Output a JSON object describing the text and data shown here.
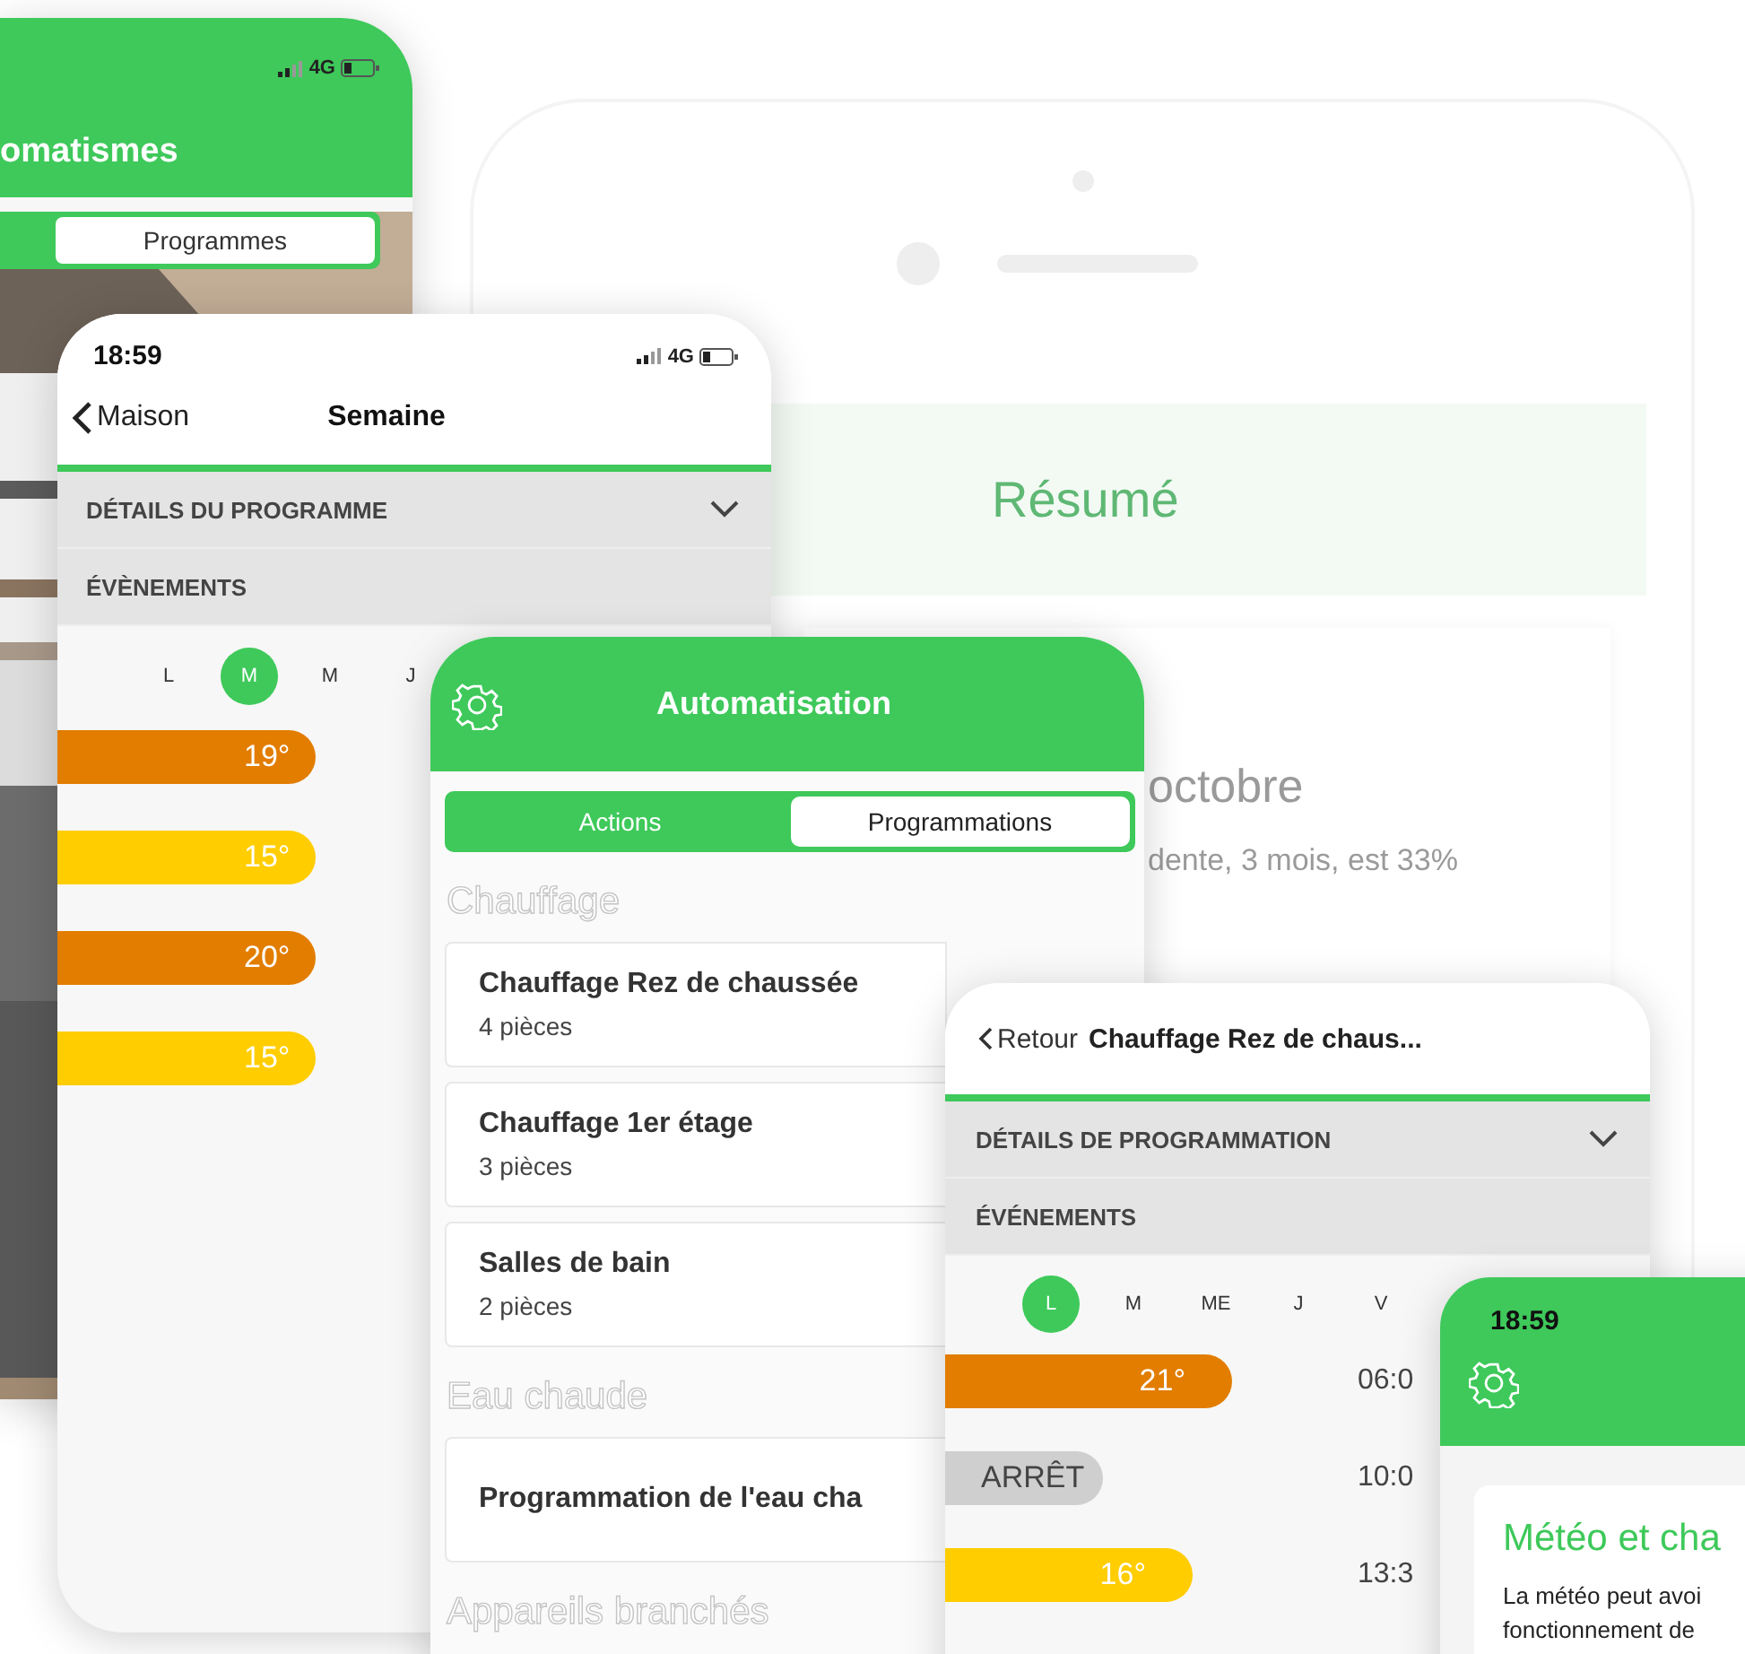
{
  "background_phone": {
    "header": "Résumé",
    "month": "octobre",
    "summary": "dente, 3 mois, est 33%"
  },
  "automatismes_screen": {
    "network": "4G",
    "title": "omatismes",
    "tabs": [
      {
        "label": "Programmes",
        "selected": true
      }
    ]
  },
  "semaine_screen": {
    "time": "18:59",
    "network": "4G",
    "back": "Maison",
    "title": "Semaine",
    "sections": [
      "DÉTAILS DU PROGRAMME",
      "ÉVÈNEMENTS"
    ],
    "days": [
      {
        "label": "L",
        "selected": false
      },
      {
        "label": "M",
        "selected": true
      },
      {
        "label": "M",
        "selected": false
      },
      {
        "label": "J",
        "selected": false
      }
    ],
    "events": [
      {
        "label": "19°",
        "color": "#e27d00"
      },
      {
        "label": "15°",
        "color": "#ffcd00"
      },
      {
        "label": "20°",
        "color": "#e27d00"
      },
      {
        "label": "15°",
        "color": "#ffcd00"
      }
    ]
  },
  "automatisation_screen": {
    "title": "Automatisation",
    "tabs": [
      {
        "label": "Actions",
        "selected": false
      },
      {
        "label": "Programmations",
        "selected": true
      }
    ],
    "groups": [
      {
        "heading": "Chauffage",
        "items": [
          {
            "title": "Chauffage Rez de chaussée",
            "subtitle": "4 pièces"
          },
          {
            "title": "Chauffage 1er étage",
            "subtitle": "3 pièces"
          },
          {
            "title": "Salles de bain",
            "subtitle": "2 pièces"
          }
        ]
      },
      {
        "heading": "Eau chaude",
        "items": [
          {
            "title": "Programmation de l'eau cha"
          }
        ]
      },
      {
        "heading": "Appareils branchés"
      }
    ]
  },
  "programmation_screen": {
    "back": "Retour",
    "title": "Chauffage Rez de chaus...",
    "sections": [
      "DÉTAILS DE PROGRAMMATION",
      "ÉVÉNEMENTS"
    ],
    "days": [
      {
        "label": "L",
        "selected": true
      },
      {
        "label": "M",
        "selected": false
      },
      {
        "label": "ME",
        "selected": false
      },
      {
        "label": "J",
        "selected": false
      },
      {
        "label": "V",
        "selected": false
      }
    ],
    "events": [
      {
        "label": "21°",
        "color": "#e27d00",
        "time": "06:0"
      },
      {
        "label": "ARRÊT",
        "color": "#cfcfcf",
        "time": "10:0"
      },
      {
        "label": "16°",
        "color": "#ffcd00",
        "time": "13:3"
      }
    ]
  },
  "meteo_screen": {
    "time": "18:59",
    "card_title": "Météo et cha",
    "card_lines": [
      "La météo peut avoi",
      "fonctionnement de"
    ]
  }
}
